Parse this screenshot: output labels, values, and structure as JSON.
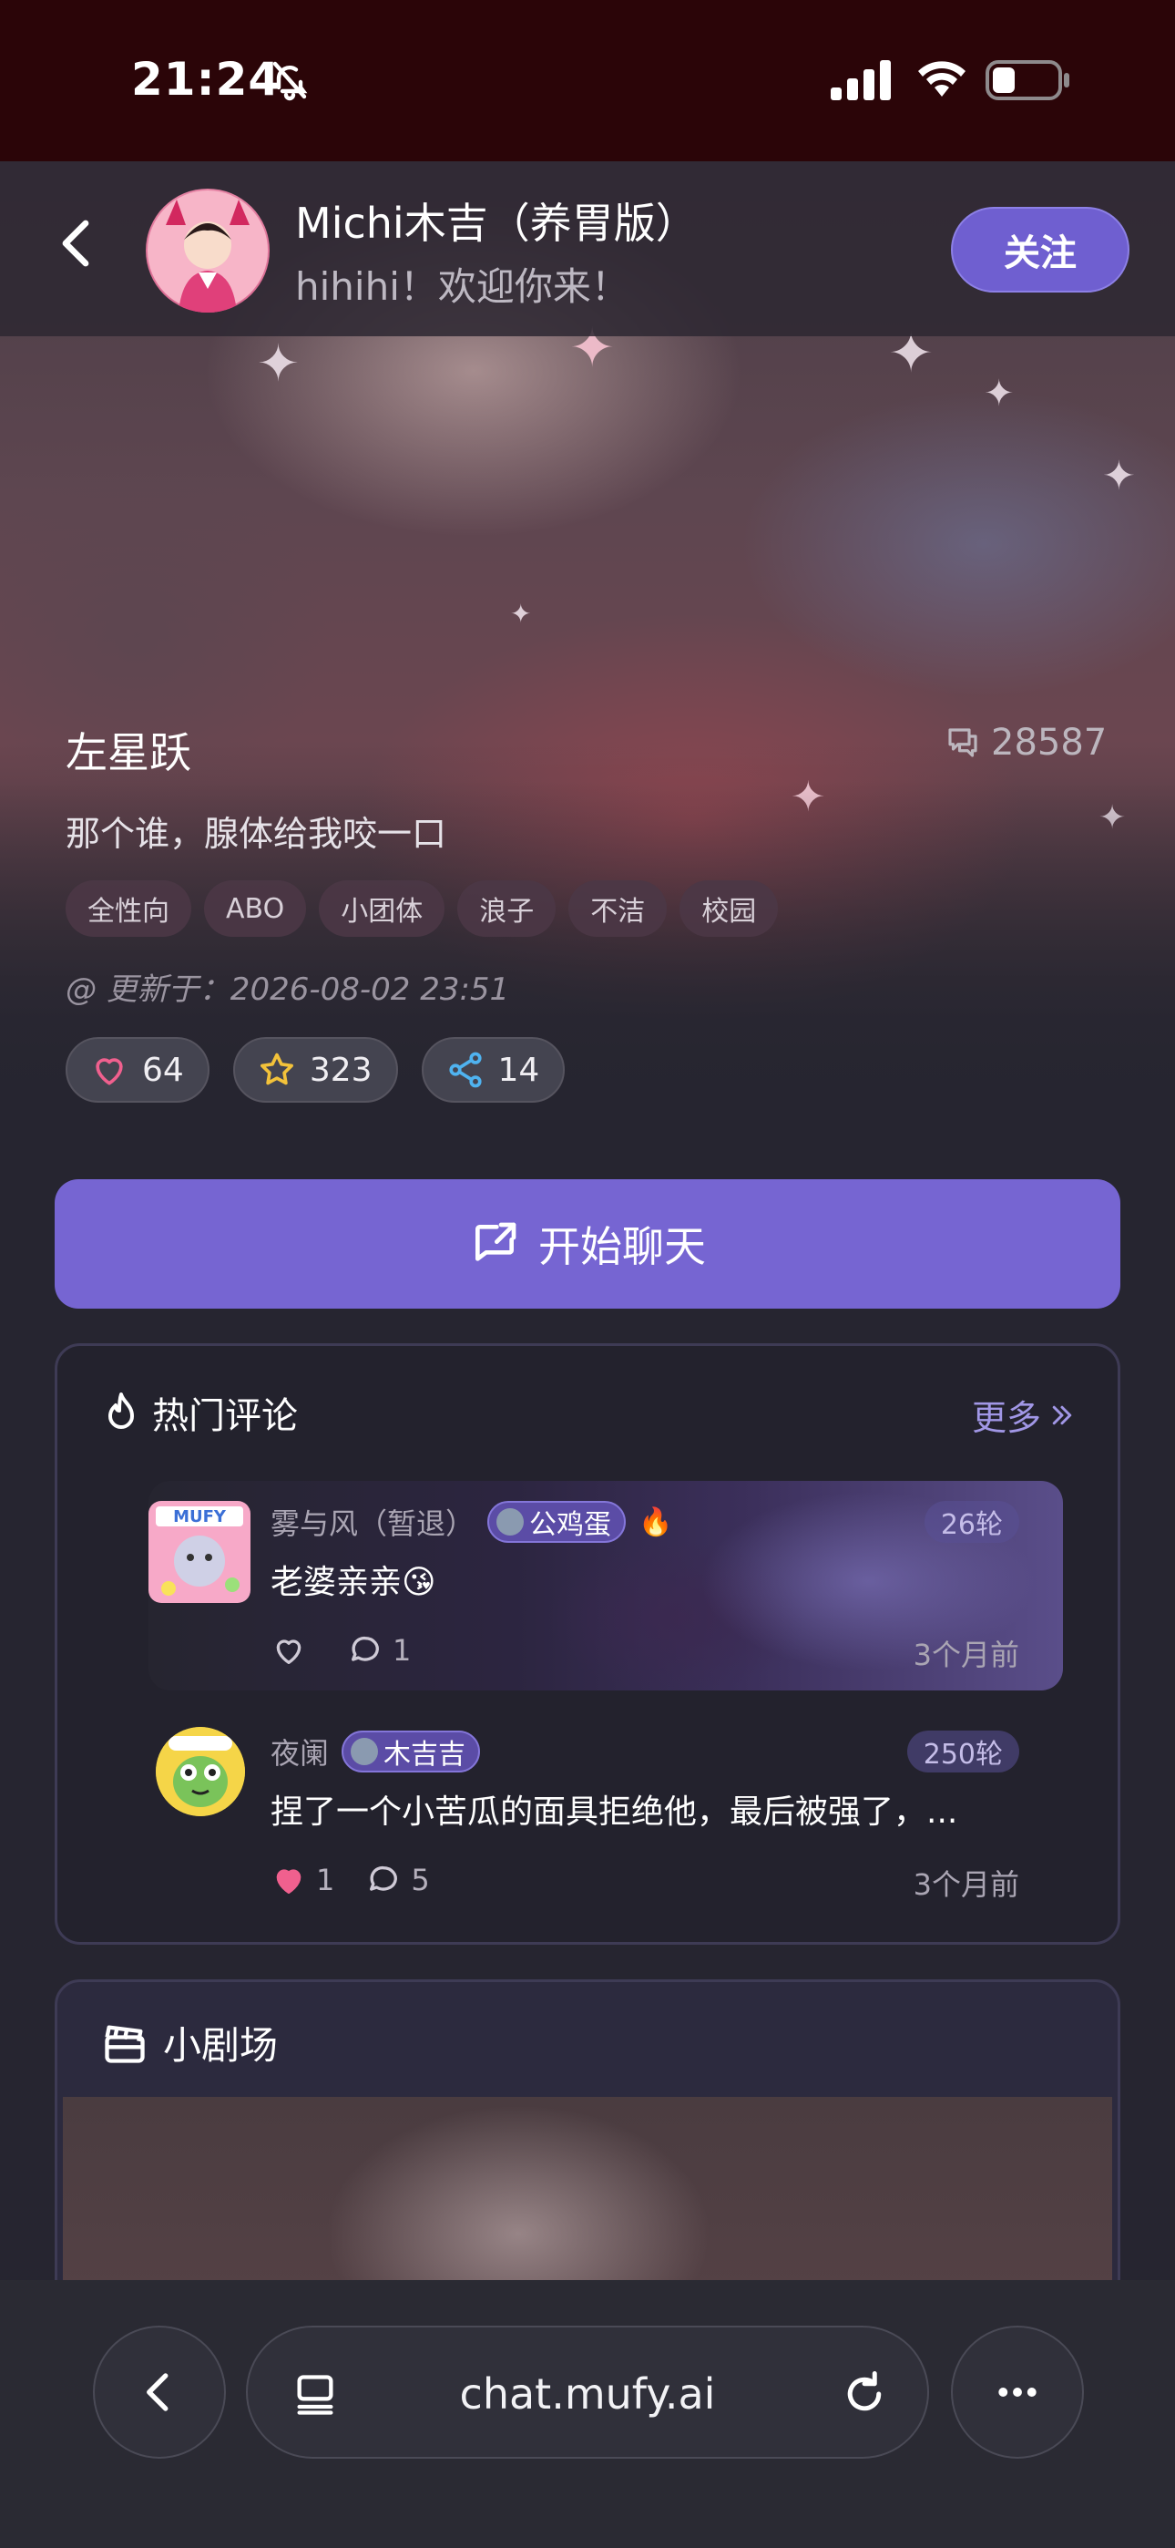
{
  "status_bar": {
    "time": "21:24"
  },
  "header": {
    "title": "Michi木吉（养胃版）",
    "subtitle": "hihihi！欢迎你来！",
    "follow_label": "关注"
  },
  "character": {
    "name": "左星跃",
    "chat_count": "28587",
    "intro": "那个谁，腺体给我咬一口",
    "tags": [
      "全性向",
      "ABO",
      "小团体",
      "浪子",
      "不洁",
      "校园"
    ],
    "updated": "@ 更新于：2026-08-02 23:51",
    "likes": "64",
    "favorites": "323",
    "shares": "14"
  },
  "start_chat_label": "开始聊天",
  "hot_comments": {
    "title": "热门评论",
    "more_label": "更多",
    "items": [
      {
        "user": "雾与风（暂退）",
        "badge": "公鸡蛋",
        "rounds": "26轮",
        "text": "老婆亲亲😘",
        "likes": "",
        "replies": "1",
        "time": "3个月前",
        "liked": false
      },
      {
        "user": "夜阑",
        "badge": "木吉吉",
        "rounds": "250轮",
        "text": "捏了一个小苦瓜的面具拒绝他，最后被强了，...",
        "likes": "1",
        "replies": "5",
        "time": "3个月前",
        "liked": true
      }
    ]
  },
  "theater": {
    "title": "小剧场"
  },
  "browser": {
    "url": "chat.mufy.ai"
  },
  "colors": {
    "accent": "#7665d2",
    "status_bg": "#2b0508",
    "page_bg": "#262530"
  }
}
